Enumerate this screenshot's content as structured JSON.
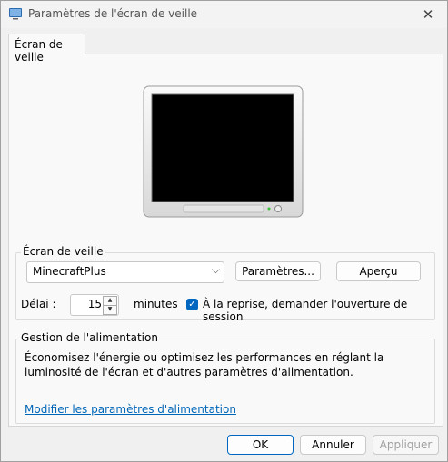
{
  "window": {
    "title": "Paramètres de l'écran de veille"
  },
  "tab": {
    "label": "Écran de veille"
  },
  "screensaver": {
    "group_label": "Écran de veille",
    "selected": "MinecraftPlus",
    "settings_button": "Paramètres...",
    "preview_button": "Aperçu",
    "delay_label": "Délai :",
    "delay_value": "15",
    "minutes_label": "minutes",
    "resume_checkbox_label": "À la reprise, demander l'ouverture de session",
    "resume_checked": true
  },
  "power": {
    "group_label": "Gestion de l'alimentation",
    "description": "Économisez l'énergie ou optimisez les performances en réglant la luminosité de l'écran et d'autres paramètres d'alimentation.",
    "link": "Modifier les paramètres d'alimentation"
  },
  "footer": {
    "ok": "OK",
    "cancel": "Annuler",
    "apply": "Appliquer"
  },
  "icons": {
    "close": "close-icon",
    "combo": "chevron-down-icon",
    "app": "screensaver-app-icon"
  },
  "colors": {
    "accent": "#0067c0",
    "link": "#0066b8"
  }
}
